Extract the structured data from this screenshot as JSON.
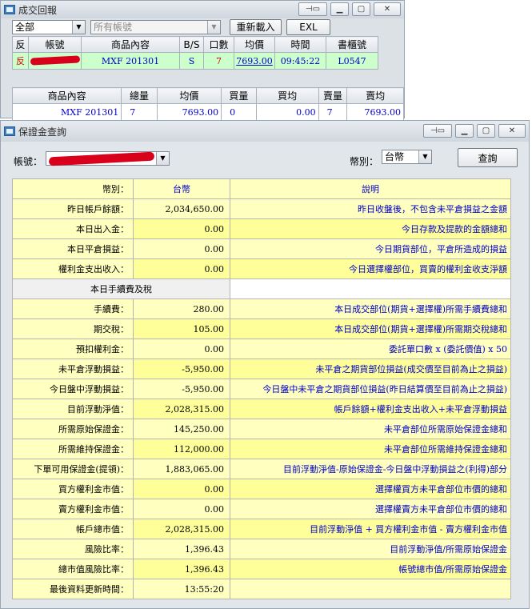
{
  "trade_window": {
    "title": "成交回報",
    "filter_value": "全部",
    "account_filter": "所有帳號",
    "reload_label": "重新載入",
    "export_label": "EXL",
    "headers": [
      "反",
      "帳號",
      "商品內容",
      "B/S",
      "口數",
      "均價",
      "時間",
      "書櫃號"
    ],
    "rows": [
      {
        "flag": "反",
        "product": "MXF 201301",
        "side": "S",
        "qty": "7",
        "price": "7693.00",
        "time": "09:45:22",
        "order_no": "L0547"
      }
    ],
    "summary_headers": [
      "商品內容",
      "總量",
      "均價",
      "買量",
      "買均",
      "賣量",
      "賣均"
    ],
    "summary_rows": [
      {
        "product": "MXF 201301",
        "total": "7",
        "avg": "7693.00",
        "buy_qty": "0",
        "buy_avg": "0.00",
        "sell_qty": "7",
        "sell_avg": "7693.00"
      }
    ]
  },
  "margin_window": {
    "title": "保證金查詢",
    "account_label": "帳號：",
    "currency_label": "幣別：",
    "currency_value": "台幣",
    "query_label": "查詢",
    "header": {
      "label": "幣別",
      "value": "台幣",
      "desc": "說明"
    },
    "section_title": "本日手續費及稅",
    "rows_top": [
      {
        "label": "昨日帳戶餘額",
        "value": "2,034,650.00",
        "desc": "昨日收盤後，不包含未平倉損益之金額"
      },
      {
        "label": "本日出入金",
        "value": "0.00",
        "desc": "今日存款及提款的金額總和"
      },
      {
        "label": "本日平倉損益",
        "value": "0.00",
        "desc": "今日期貨部位，平倉所造成的損益"
      },
      {
        "label": "權利金支出收入",
        "value": "0.00",
        "desc": "今日選擇權部位，買賣的權利金收支淨額"
      }
    ],
    "rows_bottom": [
      {
        "label": "手續費",
        "value": "280.00",
        "desc": "本日成交部位(期貨+選擇權)所需手續費總和"
      },
      {
        "label": "期交稅",
        "value": "105.00",
        "desc": "本日成交部位(期貨+選擇權)所需期交稅總和"
      },
      {
        "label": "預扣權利金",
        "value": "0.00",
        "desc": "委託單口數 x (委託價值) x 50"
      },
      {
        "label": "未平倉浮動損益",
        "value": "-5,950.00",
        "desc": "未平倉之期貨部位損益(成交價至目前為止之損益)"
      },
      {
        "label": "今日盤中浮動損益",
        "value": "-5,950.00",
        "desc": "今日盤中未平倉之期貨部位損益(昨日結算價至目前為止之損益)"
      },
      {
        "label": "目前浮動淨值",
        "value": "2,028,315.00",
        "desc": "帳戶餘額+權利金支出收入+未平倉浮動損益"
      },
      {
        "label": "所需原始保證金",
        "value": "145,250.00",
        "desc": "未平倉部位所需原始保證金總和"
      },
      {
        "label": "所需維持保證金",
        "value": "112,000.00",
        "desc": "未平倉部位所需維持保證金總和"
      },
      {
        "label": "下單可用保證金(提領)",
        "value": "1,883,065.00",
        "desc": "目前浮動淨值-原始保證金-今日盤中浮動損益之(利得)部分"
      },
      {
        "label": "買方權利金市值",
        "value": "0.00",
        "desc": "選擇權買方未平倉部位市價的總和"
      },
      {
        "label": "賣方權利金市值",
        "value": "0.00",
        "desc": "選擇權賣方未平倉部位市價的總和"
      },
      {
        "label": "帳戶總市值",
        "value": "2,028,315.00",
        "desc": "目前浮動淨值 + 買方權利金市值 - 賣方權利金市值"
      },
      {
        "label": "風險比率",
        "value": "1,396.43",
        "desc": "目前浮動淨值/所需原始保證金"
      },
      {
        "label": "總市值風險比率",
        "value": "1,396.43",
        "desc": "帳號總市值/所需原始保證金"
      },
      {
        "label": "最後資料更新時間",
        "value": "13:55:20",
        "desc": ""
      }
    ]
  },
  "colors": {
    "row_green": "#ccffcc",
    "cell_yellow": "#ffffc0",
    "desc_blue": "#0000c8",
    "flag_red": "#d40000"
  }
}
